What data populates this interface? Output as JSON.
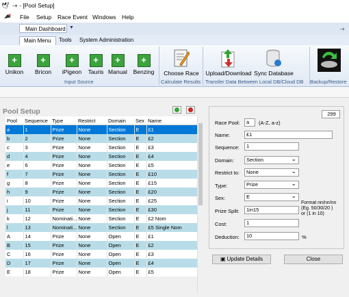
{
  "window": {
    "title": "-+ - [Pool Setup]"
  },
  "menu": {
    "items": [
      "File",
      "Setup",
      "Race Event",
      "Windows",
      "Help"
    ]
  },
  "dashboard": {
    "tab_label": "Main Dashboard"
  },
  "ribbon": {
    "tabs": [
      "Main Menu",
      "Tools",
      "System Administration"
    ],
    "input_buttons": [
      "Unikon",
      "Bricon",
      "iPigeon",
      "Tauris",
      "Manual",
      "Benzing"
    ],
    "choose_race_label": "Choose Race",
    "upload_label": "Upload/Download",
    "sync_label": "Sync Database",
    "groups": {
      "input_source": "Input Source",
      "calculate": "Calculate Results",
      "transfer": "Transfer Data Between Local DB/Cloud DB",
      "backup": "Backup/Restore"
    }
  },
  "pool_setup": {
    "title": "Pool Setup",
    "columns": [
      "Pool",
      "Sequence",
      "Type",
      "Restrict",
      "Domain",
      "Sex",
      "Name"
    ],
    "rows": [
      [
        "a",
        "1",
        "Prize",
        "None",
        "Section",
        "E",
        "£1"
      ],
      [
        "b",
        "2",
        "Prize",
        "None",
        "Section",
        "E",
        "£2"
      ],
      [
        "c",
        "3",
        "Prize",
        "None",
        "Section",
        "E",
        "£3"
      ],
      [
        "d",
        "4",
        "Prize",
        "None",
        "Section",
        "E",
        "£4"
      ],
      [
        "e",
        "6",
        "Prize",
        "None",
        "Section",
        "E",
        "£5"
      ],
      [
        "f",
        "7",
        "Prize",
        "None",
        "Section",
        "E",
        "£10"
      ],
      [
        "g",
        "8",
        "Prize",
        "None",
        "Section",
        "E",
        "£15"
      ],
      [
        "h",
        "9",
        "Prize",
        "None",
        "Section",
        "E",
        "£20"
      ],
      [
        "i",
        "10",
        "Prize",
        "None",
        "Section",
        "E",
        "£25"
      ],
      [
        "j",
        "11",
        "Prize",
        "None",
        "Section",
        "E",
        "£30"
      ],
      [
        "k",
        "12",
        "Nominati...",
        "None",
        "Section",
        "E",
        "£2 Nom"
      ],
      [
        "l",
        "13",
        "Nominati...",
        "None",
        "Section",
        "E",
        "£5 Single Nom"
      ],
      [
        "A",
        "14",
        "Prize",
        "None",
        "Open",
        "E",
        "£1"
      ],
      [
        "B",
        "15",
        "Prize",
        "None",
        "Open",
        "E",
        "£2"
      ],
      [
        "C",
        "16",
        "Prize",
        "None",
        "Open",
        "E",
        "£3"
      ],
      [
        "D",
        "17",
        "Prize",
        "None",
        "Open",
        "E",
        "£4"
      ],
      [
        "E",
        "18",
        "Prize",
        "None",
        "Open",
        "E",
        "£5"
      ]
    ]
  },
  "form": {
    "record_id": "299",
    "race_pool_label": "Race Pool:",
    "race_pool_value": "a",
    "race_pool_hint": "(A-Z, a-z)",
    "name_label": "Name:",
    "name_value": "£1",
    "sequence_label": "Sequence:",
    "sequence_value": "1",
    "domain_label": "Domain:",
    "domain_value": "Section",
    "restrict_label": "Restrict to:",
    "restrict_value": "None",
    "type_label": "Type:",
    "type_value": "Prize",
    "sex_label": "Sex:",
    "sex_value": "E",
    "prize_split_label": "Prize Split:",
    "prize_split_value": "1in15",
    "format_hint_1": "Format nn/nn/nn",
    "format_hint_2": "(Eg. 50/30/20 )",
    "format_hint_3": "or (1 in 10)",
    "cost_label": "Cost:",
    "cost_value": "1",
    "deduction_label": "Deduction:",
    "deduction_value": "10",
    "deduction_unit": "%"
  },
  "actions": {
    "update_label": "Update Details",
    "close_label": "Close"
  },
  "colors": {
    "selected_row": "#0078d7",
    "alt_row": "#b9dde8",
    "green_icon": "#3da33d",
    "red_icon": "#cc2222"
  }
}
